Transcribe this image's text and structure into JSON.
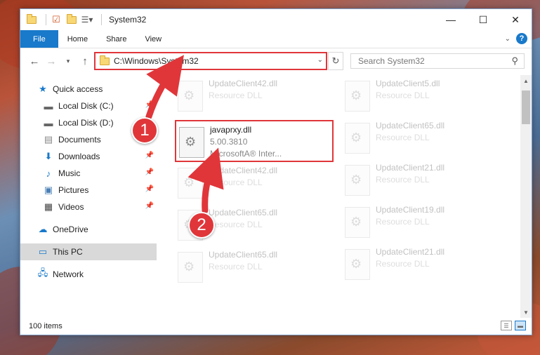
{
  "window": {
    "title": "System32"
  },
  "ribbon": {
    "tabs": [
      {
        "label": "File"
      },
      {
        "label": "Home"
      },
      {
        "label": "Share"
      },
      {
        "label": "View"
      }
    ]
  },
  "navbar": {
    "address": "C:\\Windows\\System32",
    "search_placeholder": "Search System32"
  },
  "sidebar": {
    "quick_access": "Quick access",
    "items": [
      {
        "label": "Local Disk (C:)",
        "icon": "drive-icon"
      },
      {
        "label": "Local Disk (D:)",
        "icon": "drive-icon"
      },
      {
        "label": "Documents",
        "icon": "documents-icon"
      },
      {
        "label": "Downloads",
        "icon": "downloads-icon"
      },
      {
        "label": "Music",
        "icon": "music-icon"
      },
      {
        "label": "Pictures",
        "icon": "pictures-icon"
      },
      {
        "label": "Videos",
        "icon": "videos-icon"
      }
    ],
    "onedrive": "OneDrive",
    "this_pc": "This PC",
    "network": "Network"
  },
  "files": [
    {
      "name": "UpdateClient42.dll",
      "meta": "Resource DLL"
    },
    {
      "name": "UpdateClient5.dll",
      "meta": "Resource DLL"
    },
    {
      "name": "javaprxy.dll",
      "meta": "5.00.3810",
      "meta2": "MicrosoftA® Inter..."
    },
    {
      "name": "UpdateClient65.dll",
      "meta": "Resource DLL"
    },
    {
      "name": "UpdateClient42.dll",
      "meta": "Resource DLL"
    },
    {
      "name": "UpdateClient21.dll",
      "meta": "Resource DLL"
    },
    {
      "name": "UpdateClient65.dll",
      "meta": "Resource DLL"
    },
    {
      "name": "UpdateClient19.dll",
      "meta": "Resource DLL"
    },
    {
      "name": "UpdateClient65.dll",
      "meta": "Resource DLL"
    },
    {
      "name": "UpdateClient21.dll",
      "meta": "Resource DLL"
    }
  ],
  "status": {
    "count": "100 items"
  },
  "callouts": {
    "one": "1",
    "two": "2"
  },
  "colors": {
    "accent": "#1979ca",
    "highlight": "#e0363a"
  }
}
